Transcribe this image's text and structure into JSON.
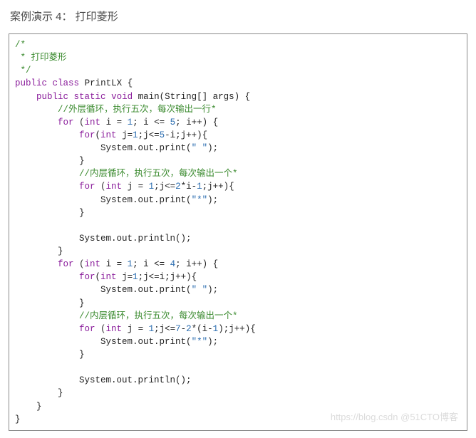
{
  "title": "案例演示 4： 打印菱形",
  "watermark": "https://blog.csdn @51CTO博客",
  "code": {
    "c1": "/*",
    "c2": " * 打印菱形",
    "c3": " */",
    "kw_public": "public",
    "kw_class": "class",
    "cls_name": "PrintLX",
    "kw_static": "static",
    "kw_void": "void",
    "fn_main": "main",
    "sig_args": "(String[] args) {",
    "cm_outer": "//外层循环，执行五次，每次输出一行*",
    "kw_for": "for",
    "kw_int": "int",
    "f1_init": "i = ",
    "n1": "1",
    "f1_cond": "; i <= ",
    "n5": "5",
    "f1_step": "; i++) {",
    "f2_full_a": "(",
    "f2_full_b": " j=",
    "f2_full_c": ";j<=",
    "f2_full_d": "-i;j++){",
    "sop": "System.out.print(",
    "sopl": "System.out.println();",
    "s_space": "\" \"",
    "s_star": "\"*\"",
    "close_paren": ");",
    "brace_close": "}",
    "cm_inner": "//内层循环，执行五次，每次输出一个*",
    "f3_a": " j = ",
    "f3_b": ";j<=",
    "n2": "2",
    "f3_c": "*i-",
    "f3_d": ";j++){",
    "n4": "4",
    "f4_cond": "; i <= ",
    "f4_step": "; i++) {",
    "f5_a": " j=",
    "f5_b": ";j<=i;j++){",
    "n7": "7",
    "f6_a": ";j<=",
    "f6_b": "-",
    "f6_c": "*(i-",
    "f6_d": ");j++){",
    "sp_brace_open": " {"
  }
}
